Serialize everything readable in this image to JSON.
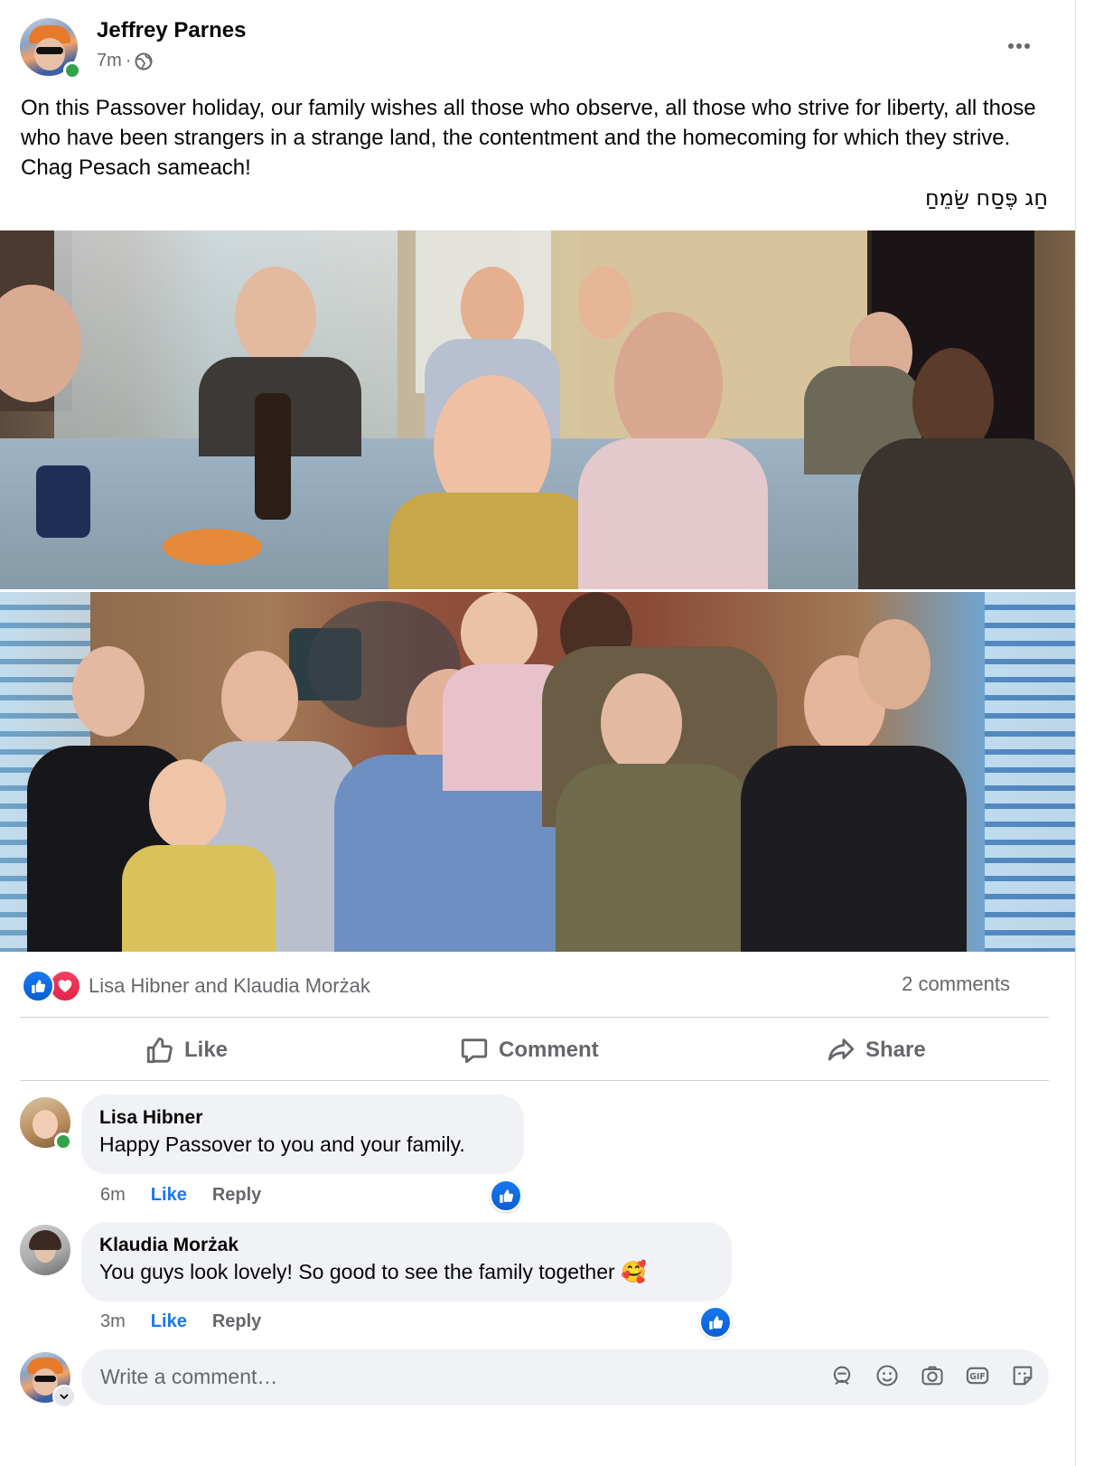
{
  "post": {
    "author": "Jeffrey Parnes",
    "time": "7m",
    "separator": "·",
    "text": "On this Passover holiday, our family wishes all those who observe, all those who strive for liberty, all those who have been strangers in a strange land, the contentment and the homecoming for which they strive. Chag Pesach sameach!",
    "hebrew": "חַג פֶּסַח שַׂמֵחַ",
    "audience_icon": "globe-icon",
    "more_icon": "more-icon"
  },
  "reactions": {
    "names": "Lisa Hibner and Klaudia Morżak",
    "comment_count": "2 comments",
    "types": [
      "like",
      "love"
    ]
  },
  "actions": {
    "like": "Like",
    "comment": "Comment",
    "share": "Share"
  },
  "comments": [
    {
      "name": "Lisa Hibner",
      "text": "Happy Passover to you and your family.",
      "time": "6m",
      "like": "Like",
      "reply": "Reply",
      "online": true
    },
    {
      "name": "Klaudia Morżak",
      "text": "You guys look lovely! So good to see the family together 🥰",
      "time": "3m",
      "like": "Like",
      "reply": "Reply",
      "online": false
    }
  ],
  "composer": {
    "placeholder": "Write a comment…",
    "icons": [
      "avatar-sticker-icon",
      "emoji-icon",
      "camera-icon",
      "gif-icon",
      "sticker-icon"
    ]
  },
  "colors": {
    "accent": "#1877f2",
    "secondary_text": "#65676b",
    "bubble": "#f0f2f5",
    "online": "#31a24c",
    "love": "#f3405f"
  }
}
